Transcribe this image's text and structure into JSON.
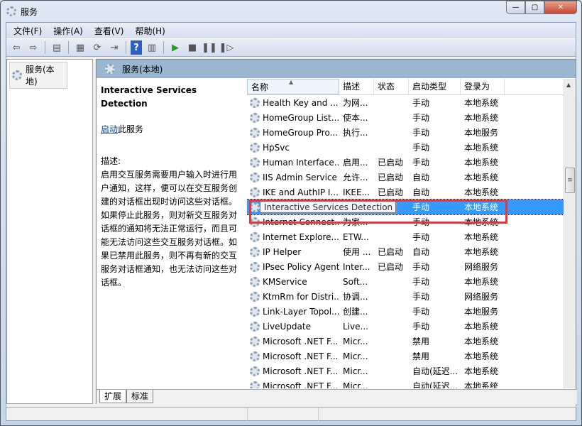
{
  "window": {
    "title": "服务",
    "controls": {
      "minimize": "—",
      "maximize": "▢",
      "close": "✕"
    }
  },
  "menu": [
    "文件(F)",
    "操作(A)",
    "查看(V)",
    "帮助(H)"
  ],
  "toolbar": [
    {
      "icon": "back-arrow-icon",
      "glyph": "⇦"
    },
    {
      "icon": "forward-arrow-icon",
      "glyph": "⇨"
    },
    {
      "icon": "show-hide-console-tree-icon",
      "glyph": "▤"
    },
    {
      "icon": "properties-icon",
      "glyph": "▦"
    },
    {
      "icon": "refresh-icon",
      "glyph": "⟳"
    },
    {
      "icon": "export-list-icon",
      "glyph": "⇥"
    },
    {
      "icon": "help-icon",
      "glyph": "?"
    },
    {
      "icon": "show-action-pane-icon",
      "glyph": "▥"
    },
    {
      "icon": "start-service-icon",
      "glyph": "▶"
    },
    {
      "icon": "stop-service-icon",
      "glyph": "■"
    },
    {
      "icon": "pause-service-icon",
      "glyph": "❚❚"
    },
    {
      "icon": "restart-service-icon",
      "glyph": "❚▷"
    }
  ],
  "tree": {
    "root": "服务(本地)"
  },
  "panel": {
    "title": "服务(本地)"
  },
  "details": {
    "service_name": "Interactive Services Detection",
    "start_link": "启动",
    "start_suffix": "此服务",
    "desc_label": "描述:",
    "desc_lines": [
      "启用交互服务需要用户输入时进行用",
      "户通知，这样，便可以在交互服务创",
      "建的对话框出现时访问这些对话框。",
      "如果停止此服务，则对新交互服务对",
      "话框的通知将无法正常运行，而且可",
      "能无法访问这些交互服务对话框。如",
      "果已禁用此服务，则不再有新的交互",
      "服务对话框通知，也无法访问这些对",
      "话框。"
    ]
  },
  "columns": [
    "名称",
    "描述",
    "状态",
    "启动类型",
    "登录为"
  ],
  "rows": [
    [
      "Health Key and ...",
      "为网...",
      "",
      "手动",
      "本地系统"
    ],
    [
      "HomeGroup List...",
      "使本...",
      "",
      "手动",
      "本地系统"
    ],
    [
      "HomeGroup Pro...",
      "执行...",
      "",
      "手动",
      "本地服务"
    ],
    [
      "HpSvc",
      "",
      "",
      "手动",
      "本地系统"
    ],
    [
      "Human Interface...",
      "启用...",
      "已启动",
      "手动",
      "本地系统"
    ],
    [
      "IIS Admin Service",
      "允许...",
      "已启动",
      "自动",
      "本地系统"
    ],
    [
      "IKE and AuthIP I...",
      "IKEE...",
      "已启动",
      "自动",
      "本地系统"
    ],
    [
      "Interactive Services Detection",
      "",
      "",
      "手动",
      "本地系统"
    ],
    [
      "Internet Connect...",
      "为家...",
      "",
      "手动",
      "本地系统"
    ],
    [
      "Internet Explore...",
      "ETW...",
      "",
      "手动",
      "本地系统"
    ],
    [
      "IP Helper",
      "使用 ...",
      "已启动",
      "自动",
      "本地系统"
    ],
    [
      "IPsec Policy Agent",
      "Inter...",
      "已启动",
      "手动",
      "网络服务"
    ],
    [
      "KMService",
      "Soft...",
      "",
      "手动",
      "本地系统"
    ],
    [
      "KtmRm for Distri...",
      "协调...",
      "",
      "手动",
      "网络服务"
    ],
    [
      "Link-Layer Topol...",
      "创建...",
      "",
      "手动",
      "本地服务"
    ],
    [
      "LiveUpdate",
      "Live...",
      "",
      "手动",
      "本地系统"
    ],
    [
      "Microsoft .NET F...",
      "Micr...",
      "",
      "禁用",
      "本地系统"
    ],
    [
      "Microsoft .NET F...",
      "Micr...",
      "",
      "禁用",
      "本地系统"
    ],
    [
      "Microsoft .NET F...",
      "Micr...",
      "",
      "自动(延迟...",
      "本地系统"
    ],
    [
      "Microsoft .NET F...",
      "Micr...",
      "",
      "自动(延迟...",
      "本地系统"
    ]
  ],
  "selected_row": 7,
  "tooltip": "Interactive Services Detection",
  "tabs": [
    "扩展",
    "标准"
  ],
  "colors": {
    "selection": "#3399ff",
    "highlight_box": "#e23a3a",
    "panel_header": "#9bb6d1"
  }
}
